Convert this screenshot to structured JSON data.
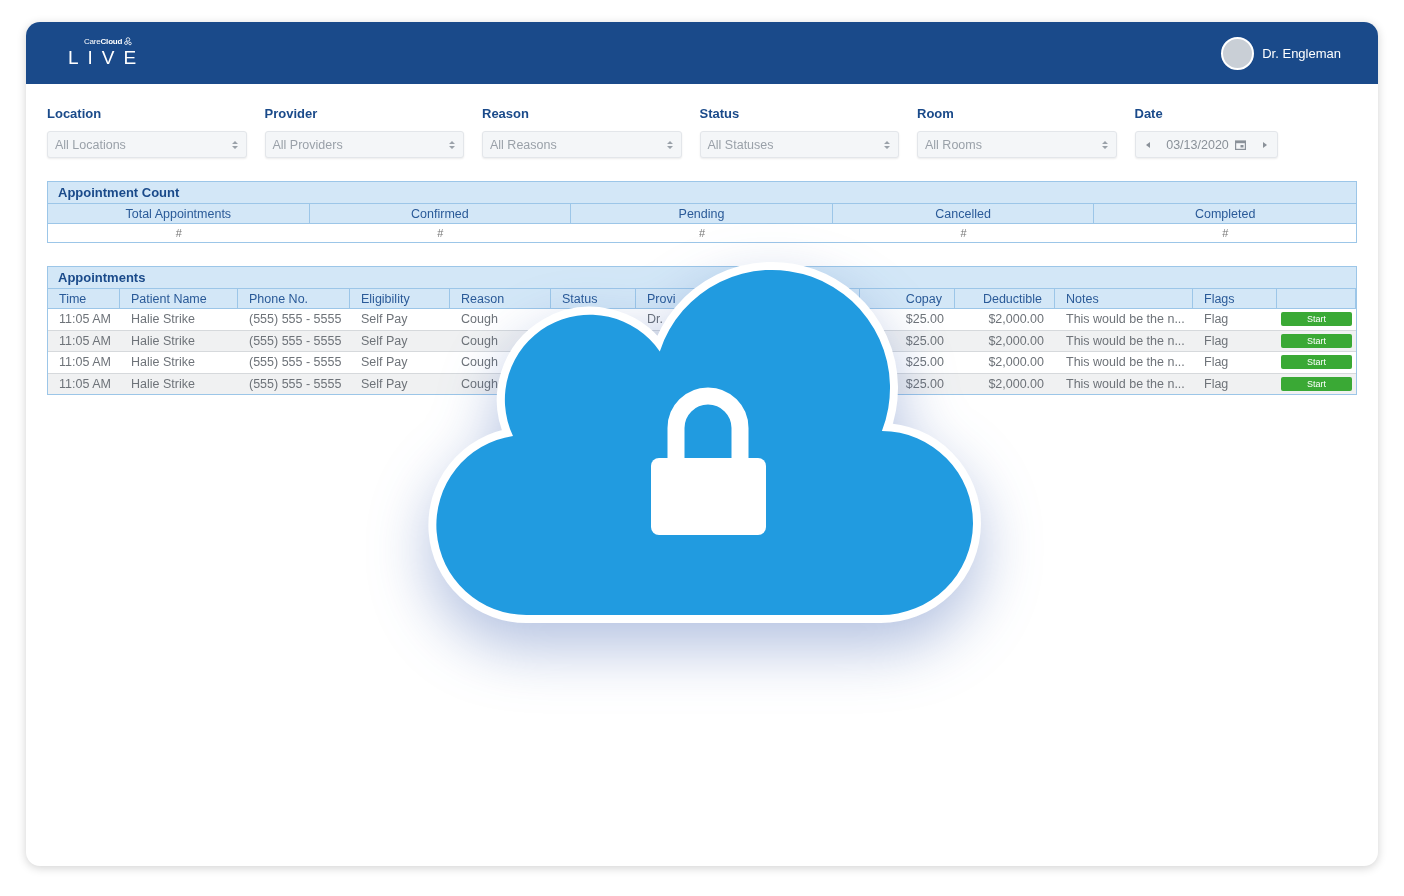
{
  "header": {
    "logo_brand": "Care**Cloud**",
    "logo_title": "LIVE",
    "user_name": "Dr. Engleman"
  },
  "filters": [
    {
      "label": "Location",
      "value": "All Locations",
      "kind": "select"
    },
    {
      "label": "Provider",
      "value": "All Providers",
      "kind": "select"
    },
    {
      "label": "Reason",
      "value": "All Reasons",
      "kind": "select"
    },
    {
      "label": "Status",
      "value": "All Statuses",
      "kind": "select"
    },
    {
      "label": "Room",
      "value": "All Rooms",
      "kind": "select"
    },
    {
      "label": "Date",
      "value": "03/13/2020",
      "kind": "date"
    }
  ],
  "appointment_count": {
    "title": "Appointment Count",
    "columns": [
      "Total Appointments",
      "Confirmed",
      "Pending",
      "Cancelled",
      "Completed"
    ],
    "values": [
      "#",
      "#",
      "#",
      "#",
      "#"
    ]
  },
  "appointments": {
    "title": "Appointments",
    "columns": [
      "Time",
      "Patient Name",
      "Phone No.",
      "Eligibility",
      "Reason",
      "Status",
      "Provi",
      "Copay",
      "Deductible",
      "Notes",
      "Flags"
    ],
    "rows": [
      {
        "time": "11:05 AM",
        "patient_name": "Halie Strike",
        "phone": "(555) 555 - 5555",
        "eligibility": "Self Pay",
        "reason": "Cough",
        "provider": "Dr.",
        "copay": "$25.00",
        "deductible": "$2,000.00",
        "notes": "This would be the n...",
        "flag": "Flag",
        "action": "Start"
      },
      {
        "time": "11:05 AM",
        "patient_name": "Halie Strike",
        "phone": "(555) 555 - 5555",
        "eligibility": "Self Pay",
        "reason": "Cough",
        "copay": "$25.00",
        "deductible": "$2,000.00",
        "notes": "This would be the n...",
        "flag": "Flag",
        "action": "Start"
      },
      {
        "time": "11:05 AM",
        "patient_name": "Halie Strike",
        "phone": "(555) 555 - 5555",
        "eligibility": "Self Pay",
        "reason": "Cough",
        "copay": "$25.00",
        "deductible": "$2,000.00",
        "notes": "This would be the n...",
        "flag": "Flag",
        "action": "Start"
      },
      {
        "time": "11:05 AM",
        "patient_name": "Halie Strike",
        "phone": "(555) 555 - 5555",
        "eligibility": "Self Pay",
        "reason": "Cough",
        "copay": "$25.00",
        "deductible": "$2,000.00",
        "notes": "This would be the n...",
        "flag": "Flag",
        "action": "Start"
      }
    ]
  }
}
